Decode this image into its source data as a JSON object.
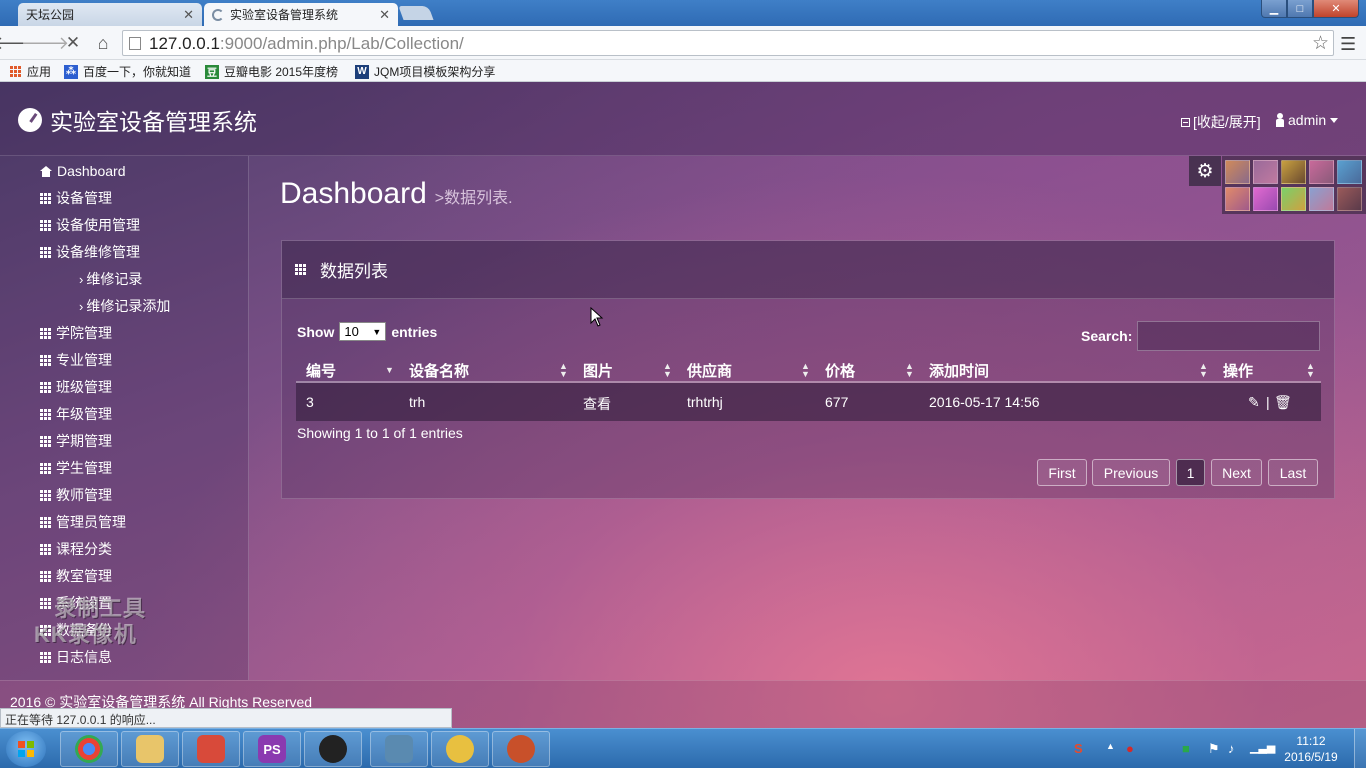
{
  "browser": {
    "tabs": [
      {
        "label": "天坛公园",
        "active": false
      },
      {
        "label": "实验室设备管理系统",
        "active": true
      }
    ],
    "url_host": "127.0.0.1",
    "url_rest": ":9000/admin.php/Lab/Collection/",
    "bookmarks": [
      {
        "label": "应用",
        "icon": "apps-grid-icon"
      },
      {
        "label": "百度一下，你就知道",
        "icon": "baidu-icon"
      },
      {
        "label": "豆瓣电影 2015年度榜",
        "icon": "douban-icon"
      },
      {
        "label": "JQM项目模板架构分享",
        "icon": "w-icon"
      }
    ],
    "status": "正在等待 127.0.0.1 的响应..."
  },
  "header": {
    "brand": "实验室设备管理系统",
    "collapse": "[收起/展开]",
    "user": "admin"
  },
  "sidebar": {
    "items": [
      {
        "label": "Dashboard",
        "icon": "home-icon"
      },
      {
        "label": "设备管理",
        "icon": "grid-icon"
      },
      {
        "label": "设备使用管理",
        "icon": "grid-icon"
      },
      {
        "label": "设备维修管理",
        "icon": "grid-icon"
      },
      {
        "label": "维修记录",
        "icon": "chevron-right-icon",
        "sub": true
      },
      {
        "label": "维修记录添加",
        "icon": "chevron-right-icon",
        "sub": true
      },
      {
        "label": "学院管理",
        "icon": "grid-icon"
      },
      {
        "label": "专业管理",
        "icon": "grid-icon"
      },
      {
        "label": "班级管理",
        "icon": "grid-icon"
      },
      {
        "label": "年级管理",
        "icon": "grid-icon"
      },
      {
        "label": "学期管理",
        "icon": "grid-icon"
      },
      {
        "label": "学生管理",
        "icon": "grid-icon"
      },
      {
        "label": "教师管理",
        "icon": "grid-icon"
      },
      {
        "label": "管理员管理",
        "icon": "grid-icon"
      },
      {
        "label": "课程分类",
        "icon": "grid-icon"
      },
      {
        "label": "教室管理",
        "icon": "grid-icon"
      },
      {
        "label": "系统设置",
        "icon": "grid-icon"
      },
      {
        "label": "数据备份",
        "icon": "grid-icon"
      },
      {
        "label": "日志信息",
        "icon": "grid-icon"
      }
    ]
  },
  "page": {
    "title": "Dashboard",
    "subtitle": ">数据列表."
  },
  "panel": {
    "title": "数据列表",
    "show_label": "Show",
    "page_size": "10",
    "entries_label": "entries",
    "search_label": "Search:",
    "columns": [
      "编号",
      "设备名称",
      "图片",
      "供应商",
      "价格",
      "添加时间",
      "操作"
    ],
    "rows": [
      {
        "id": "3",
        "name": "trh",
        "image": "查看",
        "supplier": "trhtrhj",
        "price": "677",
        "added": "2016-05-17 14:56",
        "edit_sep": "|"
      }
    ],
    "info": "Showing 1 to 1 of 1 entries",
    "pagination": [
      "First",
      "Previous",
      "1",
      "Next",
      "Last"
    ],
    "current_page": "1"
  },
  "footer": {
    "text": "2016 © 实验室设备管理系统 All Rights Reserved"
  },
  "watermark": {
    "line1": "录制工具",
    "line2": "KK录像机"
  },
  "taskbar": {
    "apps": [
      "chrome-icon",
      "explorer-icon",
      "editor-icon",
      "phpstorm-icon",
      "qq-icon",
      "image-viewer-icon",
      "paint-icon",
      "game-icon"
    ],
    "ps_label": "PS",
    "time": "11:12",
    "date": "2016/5/19"
  },
  "colors": {
    "accent": "#7a4f86",
    "taskbar": "#2c6aac"
  }
}
